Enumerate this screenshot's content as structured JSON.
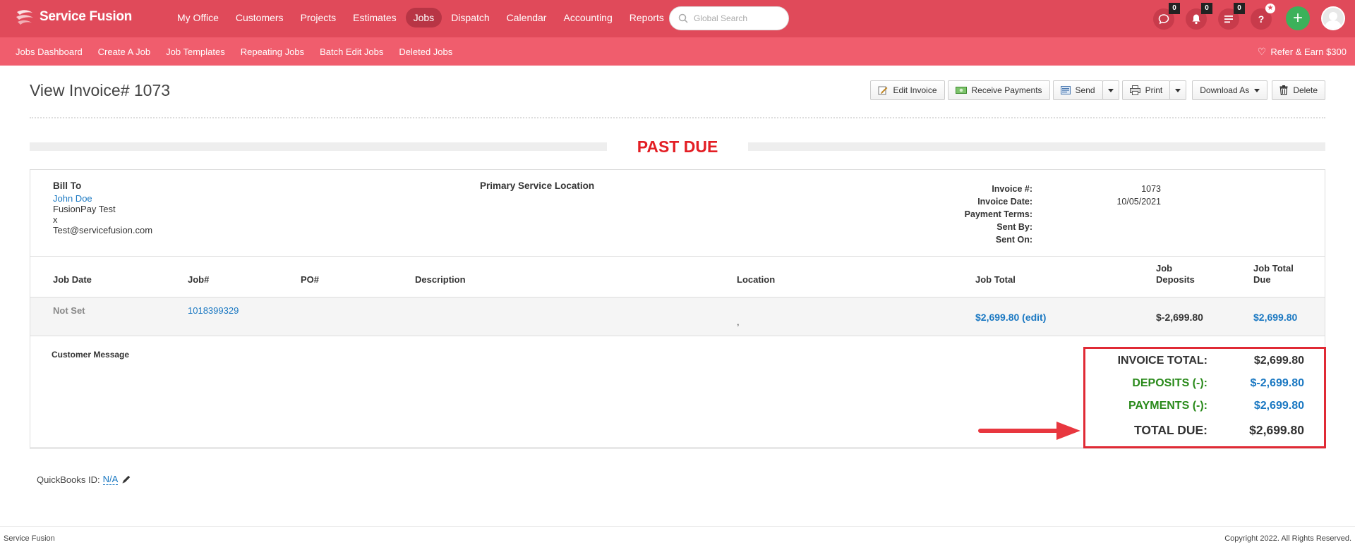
{
  "brand": {
    "name": "Service Fusion"
  },
  "main_nav": [
    {
      "label": "My Office",
      "active": false
    },
    {
      "label": "Customers",
      "active": false
    },
    {
      "label": "Projects",
      "active": false
    },
    {
      "label": "Estimates",
      "active": false
    },
    {
      "label": "Jobs",
      "active": true
    },
    {
      "label": "Dispatch",
      "active": false
    },
    {
      "label": "Calendar",
      "active": false
    },
    {
      "label": "Accounting",
      "active": false
    },
    {
      "label": "Reports",
      "active": false
    }
  ],
  "search": {
    "placeholder": "Global Search"
  },
  "notifications": {
    "chat_count": "0",
    "bell_count": "0",
    "list_count": "0",
    "help_label": "?",
    "plus_label": "+"
  },
  "sub_nav": [
    "Jobs Dashboard",
    "Create A Job",
    "Job Templates",
    "Repeating Jobs",
    "Batch Edit Jobs",
    "Deleted Jobs"
  ],
  "refer": {
    "label": "Refer & Earn $300"
  },
  "page": {
    "title": "View Invoice# 1073"
  },
  "actions": {
    "edit_invoice": "Edit Invoice",
    "receive_payments": "Receive Payments",
    "send": "Send",
    "print": "Print",
    "download_as": "Download As",
    "delete": "Delete"
  },
  "status": {
    "label": "PAST DUE",
    "color": "#e31e24"
  },
  "bill_to": {
    "label": "Bill To",
    "name": "John Doe",
    "company": "FusionPay Test",
    "line3": "x",
    "email": "Test@servicefusion.com"
  },
  "primary_service_location": {
    "label": "Primary Service Location"
  },
  "invoice_meta": [
    {
      "key": "Invoice #:",
      "value": "1073"
    },
    {
      "key": "Invoice Date:",
      "value": "10/05/2021"
    },
    {
      "key": "Payment Terms:",
      "value": ""
    },
    {
      "key": "Sent By:",
      "value": ""
    },
    {
      "key": "Sent On:",
      "value": ""
    }
  ],
  "table": {
    "headers": {
      "job_date": "Job Date",
      "job_no": "Job#",
      "po_no": "PO#",
      "description": "Description",
      "location": "Location",
      "job_total": "Job Total",
      "job_deposits_1": "Job",
      "job_deposits_2": "Deposits",
      "job_total_due_1": "Job Total",
      "job_total_due_2": "Due"
    },
    "row": {
      "job_date": "Not Set",
      "job_no": "1018399329",
      "po_no": "",
      "description": "",
      "location": ",",
      "job_total": "$2,699.80 (edit)",
      "job_deposits": "$-2,699.80",
      "job_total_due": "$2,699.80"
    }
  },
  "customer_message": {
    "label": "Customer Message"
  },
  "totals": {
    "invoice_total": {
      "label": "INVOICE TOTAL:",
      "value": "$2,699.80"
    },
    "deposits": {
      "label": "DEPOSITS (-):",
      "value": "$-2,699.80"
    },
    "payments": {
      "label": "PAYMENTS (-):",
      "value": "$2,699.80"
    },
    "total_due": {
      "label": "TOTAL DUE:",
      "value": "$2,699.80"
    }
  },
  "quickbooks": {
    "label": "QuickBooks ID:",
    "value": "N/A"
  },
  "footer": {
    "left": "Service Fusion",
    "right": "Copyright 2022. All Rights Reserved."
  },
  "colors": {
    "topbar": "#e04a5a",
    "subbar": "#f05d6d",
    "link": "#1a78c2",
    "green": "#2a8a1b",
    "highlight": "#e02a35"
  },
  "icons": [
    "chat-icon",
    "bell-icon",
    "list-icon",
    "help-icon",
    "plus-icon",
    "heart-icon",
    "edit-icon",
    "money-icon",
    "send-icon",
    "print-icon",
    "trash-icon",
    "pencil-icon",
    "search-icon"
  ]
}
